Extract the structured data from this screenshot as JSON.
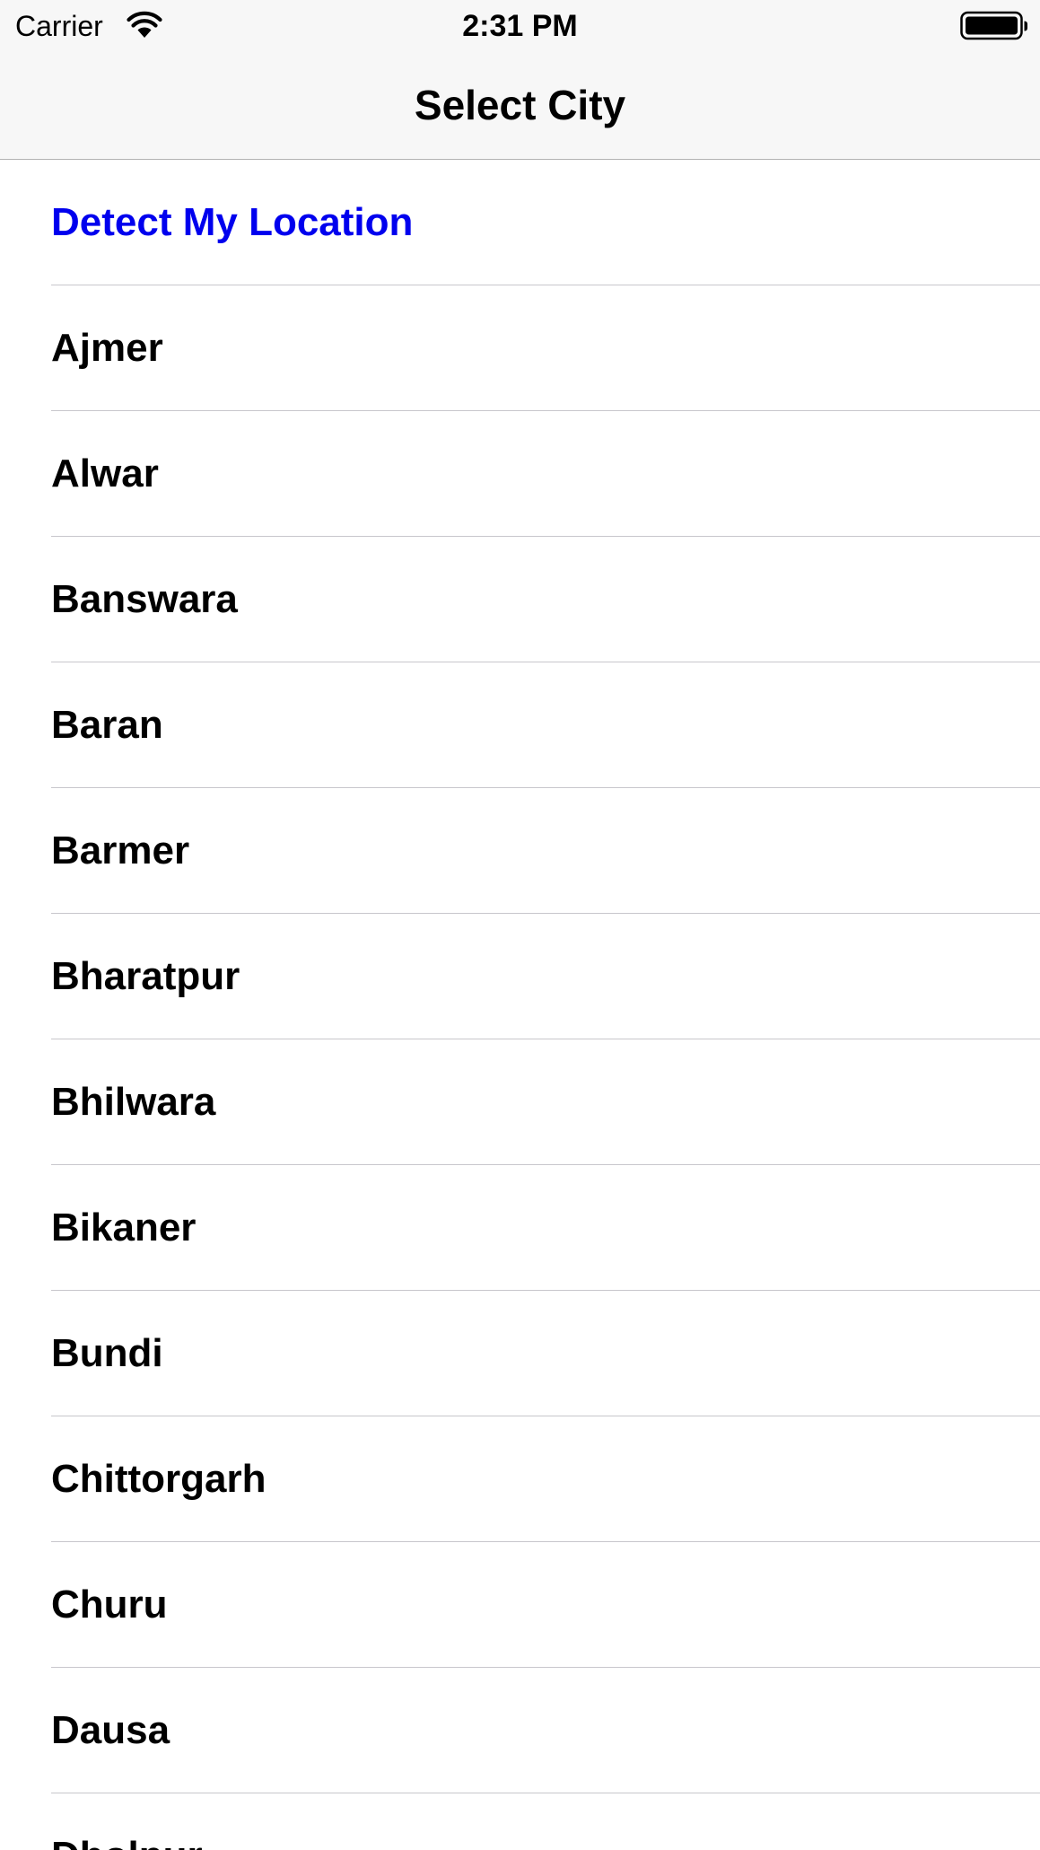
{
  "status_bar": {
    "carrier": "Carrier",
    "time": "2:31 PM",
    "wifi_icon": "wifi-icon",
    "battery_icon": "battery-icon"
  },
  "nav": {
    "title": "Select City"
  },
  "detect_location": {
    "label": "Detect My Location",
    "color": "#0000EE"
  },
  "cities": [
    "Ajmer",
    "Alwar",
    "Banswara",
    "Baran",
    "Barmer",
    "Bharatpur",
    "Bhilwara",
    "Bikaner",
    "Bundi",
    "Chittorgarh",
    "Churu",
    "Dausa",
    "Dholpur"
  ],
  "colors": {
    "bar_background": "#F7F7F7",
    "separator": "#C8C7CC",
    "text": "#000000"
  }
}
